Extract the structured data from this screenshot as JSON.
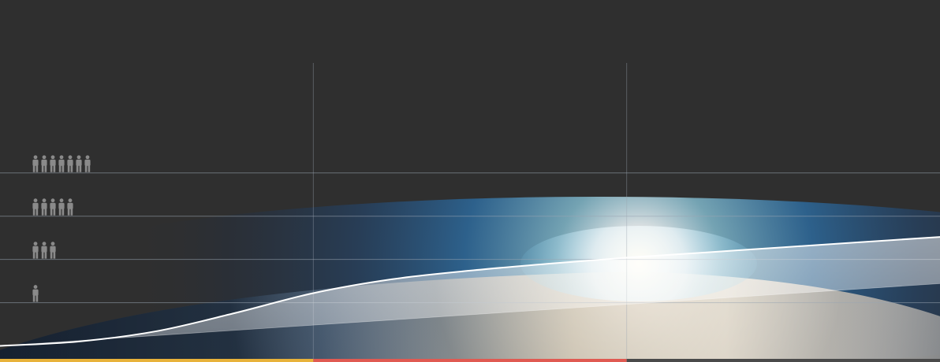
{
  "chart_data": {
    "type": "area",
    "x": [
      0,
      1,
      2,
      3,
      4,
      5,
      6,
      7,
      8,
      9,
      10,
      11,
      12
    ],
    "series": [
      {
        "values": [
          0,
          0.05,
          0.17,
          0.38,
          0.61,
          0.77,
          0.87,
          0.95,
          1.02,
          1.08,
          1.14,
          1.2,
          1.26
        ]
      },
      {
        "values": [
          0,
          0.06,
          0.12,
          0.18,
          0.24,
          0.3,
          0.36,
          0.42,
          0.48,
          0.54,
          0.6,
          0.66,
          0.72
        ]
      }
    ],
    "xlim": [
      0,
      12
    ],
    "ylim": [
      -0.05,
      4
    ],
    "gridlines_y": [
      0.5,
      1.0,
      1.5,
      2.0
    ],
    "gridlines_x": [
      4,
      8
    ],
    "axis_icons": [
      {
        "y": 0.5,
        "count": 1,
        "icon": "person-icon"
      },
      {
        "y": 1.0,
        "count": 3,
        "icon": "person-icon"
      },
      {
        "y": 1.5,
        "count": 5,
        "icon": "person-icon"
      },
      {
        "y": 2.0,
        "count": 7,
        "icon": "person-icon"
      }
    ],
    "segments": [
      {
        "color": "#e8b23a"
      },
      {
        "color": "#e05a52"
      },
      {
        "color": "#4a4a4a"
      }
    ],
    "background": "earth-from-space-sunrise",
    "colors": {
      "background": "#2f2f2f",
      "line": "#ffffff",
      "grid": "#9aa6b2",
      "icons": "#8a8a8a"
    }
  }
}
